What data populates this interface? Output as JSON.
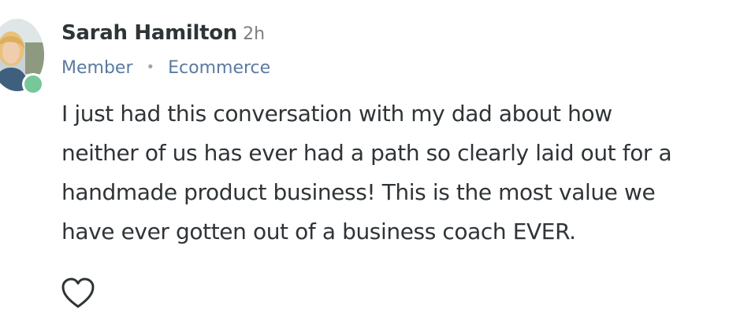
{
  "author": {
    "name": "Sarah Hamilton",
    "time": "2h",
    "role": "Member",
    "separator": "•",
    "space": "Ecommerce"
  },
  "post": {
    "lines": [
      "I just had this conversation with my dad about how",
      "neither of us has ever had a path so clearly laid out for a",
      "handmade product business! This is the most value we",
      "have ever gotten out of a business coach EVER."
    ]
  },
  "icons": {
    "avatar": "user-photo",
    "status": "online-indicator",
    "like": "heart-icon"
  },
  "colors": {
    "text": "#2f3437",
    "meta": "#5a7aa0",
    "time": "#7a7f85",
    "online": "#76c79a"
  }
}
